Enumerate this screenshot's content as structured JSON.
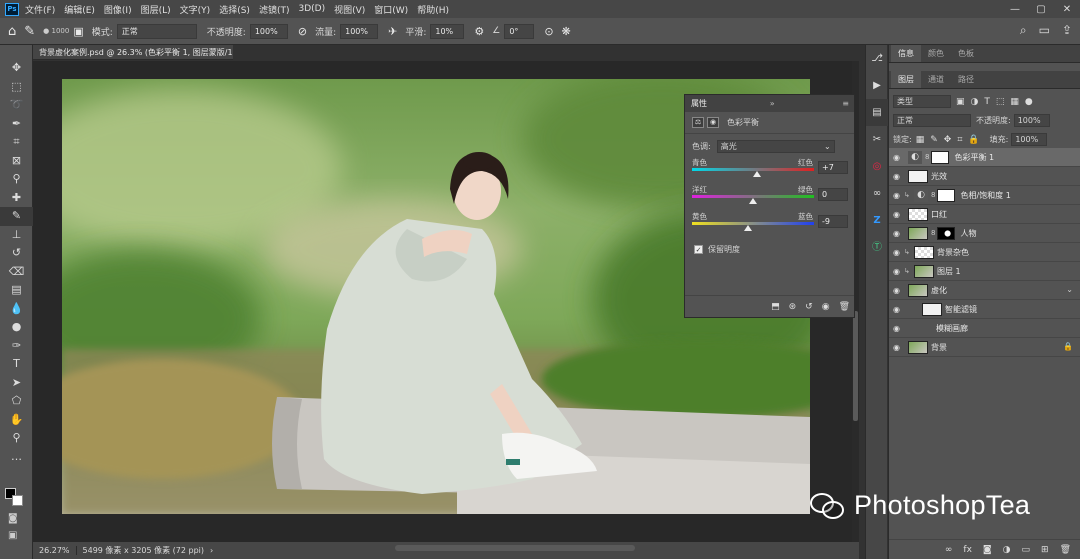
{
  "app": {
    "logo": "Ps"
  },
  "menu": [
    "文件(F)",
    "编辑(E)",
    "图像(I)",
    "图层(L)",
    "文字(Y)",
    "选择(S)",
    "滤镜(T)",
    "3D(D)",
    "视图(V)",
    "窗口(W)",
    "帮助(H)"
  ],
  "window_controls": [
    "—",
    "▢",
    "✕"
  ],
  "options": {
    "brush_size": "1000",
    "mode_label": "模式:",
    "mode_value": "正常",
    "opacity_label": "不透明度:",
    "opacity_value": "100%",
    "flow_label": "流量:",
    "flow_value": "100%",
    "smooth_label": "平滑:",
    "smooth_value": "10%",
    "angle_value": "0°"
  },
  "document": {
    "tab": "背景虚化案例.psd @ 26.3% (色彩平衡 1, 图层蒙版/16) *"
  },
  "status": {
    "zoom": "26.27%",
    "doc_info": "5499 像素 x 3205 像素 (72 ppi)"
  },
  "properties": {
    "tab": "属性",
    "title": "色彩平衡",
    "tone_label": "色调:",
    "tone_value": "高光",
    "sliders": [
      {
        "left": "青色",
        "right": "红色",
        "value": "+7",
        "position": 0.535,
        "gradient": [
          "#00d8e8",
          "#e02020"
        ]
      },
      {
        "left": "洋红",
        "right": "绿色",
        "value": "0",
        "position": 0.5,
        "gradient": [
          "#e020e0",
          "#20c020"
        ]
      },
      {
        "left": "黄色",
        "right": "蓝色",
        "value": "-9",
        "position": 0.455,
        "gradient": [
          "#f0e020",
          "#2040f0"
        ]
      }
    ],
    "preserve_label": "保留明度",
    "preserve_checked": true
  },
  "right_panel": {
    "top_tabs": [
      "信息",
      "颜色",
      "色板"
    ],
    "layer_tabs": [
      "图层",
      "通道",
      "路径"
    ],
    "filter_kind": "类型",
    "blend_mode": "正常",
    "opacity_label": "不透明度:",
    "opacity_value": "100%",
    "lock_label": "锁定:",
    "fill_label": "填充:",
    "fill_value": "100%"
  },
  "layers": [
    {
      "name": "色彩平衡 1",
      "selected": true,
      "thumb": "adj",
      "mask": true
    },
    {
      "name": "光效",
      "selected": false,
      "thumb": "white"
    },
    {
      "name": "色相/饱和度 1",
      "selected": false,
      "thumb": "adj",
      "mask": true,
      "clip": true
    },
    {
      "name": "口红",
      "selected": false,
      "thumb": "check"
    },
    {
      "name": "人物",
      "selected": false,
      "thumb": "photo",
      "mask": "dark"
    },
    {
      "name": "背景杂色",
      "selected": false,
      "thumb": "check",
      "clip": true
    },
    {
      "name": "图层 1",
      "selected": false,
      "thumb": "photo",
      "clip": true
    },
    {
      "name": "虚化",
      "selected": false,
      "thumb": "photo",
      "smart": true
    },
    {
      "name": "智能滤镜",
      "selected": false,
      "thumb": "white",
      "indent": 1
    },
    {
      "name": "模糊画廊",
      "selected": false,
      "indent": 2
    },
    {
      "name": "背景",
      "selected": false,
      "thumb": "photo",
      "locked": true
    }
  ],
  "watermark": {
    "text": "PhotoshopTea"
  },
  "colors": {
    "ui_bg": "#535353",
    "canvas_bg": "#282828",
    "selected_layer": "#696969",
    "accent": "#31a8ff"
  }
}
